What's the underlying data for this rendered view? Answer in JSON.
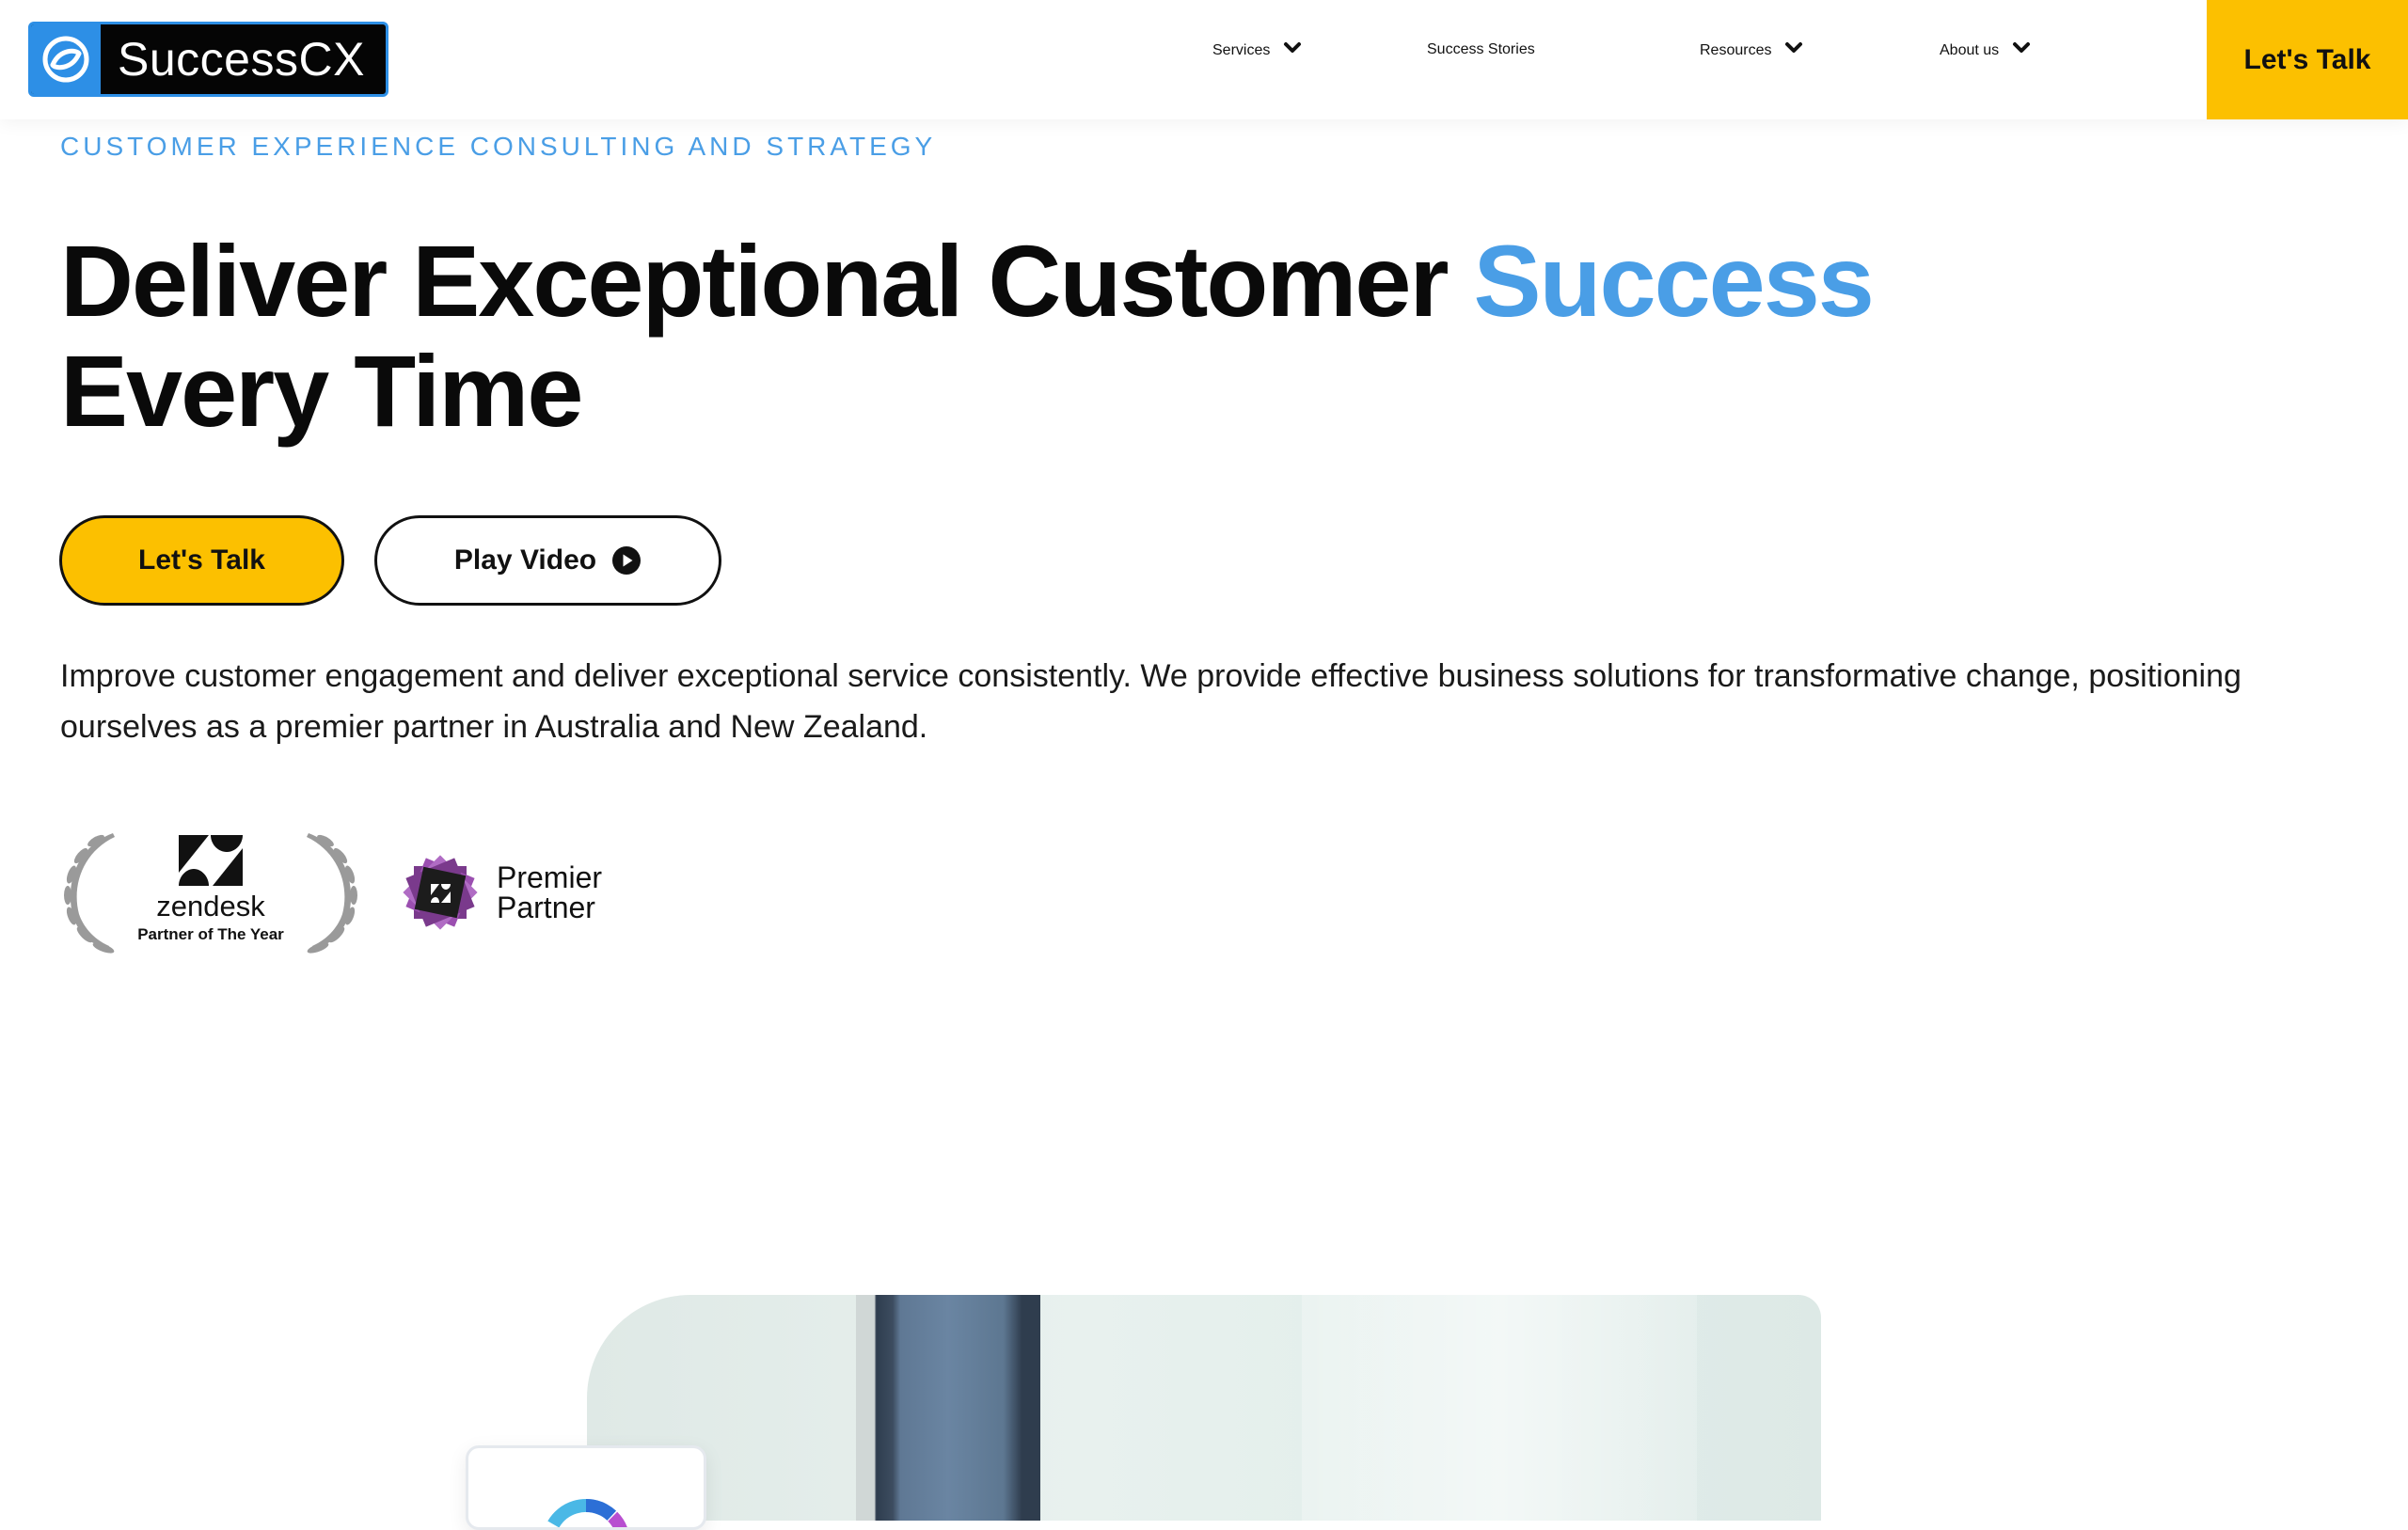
{
  "header": {
    "logo_text": "SuccessCX",
    "nav": [
      {
        "label": "Services",
        "has_dropdown": true
      },
      {
        "label": "Success Stories",
        "has_dropdown": false
      },
      {
        "label": "Resources",
        "has_dropdown": true
      },
      {
        "label": "About us",
        "has_dropdown": true
      }
    ],
    "cta_label": "Let's Talk"
  },
  "hero": {
    "eyebrow": "CUSTOMER EXPERIENCE CONSULTING AND STRATEGY",
    "headline_part1": "Deliver Exceptional Customer ",
    "headline_accent": "Success",
    "headline_part2": "Every Time",
    "primary_button": "Let's Talk",
    "secondary_button": "Play Video",
    "lead": "Improve customer engagement and deliver exceptional service consistently. We provide effective business solutions for transformative change, positioning ourselves as a premier partner in Australia and New Zealand."
  },
  "badges": {
    "zendesk_word": "zendesk",
    "zendesk_award": "Partner of The Year",
    "premier_line1": "Premier",
    "premier_line2": "Partner"
  },
  "icons": {
    "logo": "successcx-logo-icon",
    "dropdown": "chevron-down-icon",
    "play": "play-circle-icon",
    "laurel": "laurel-wreath-icon",
    "zendesk": "zendesk-logo-icon"
  },
  "colors": {
    "accent_blue": "#4a9ee6",
    "cta_yellow": "#fcc000",
    "text_dark": "#0a0a0a",
    "premier_purple": "#7a3a8c"
  }
}
